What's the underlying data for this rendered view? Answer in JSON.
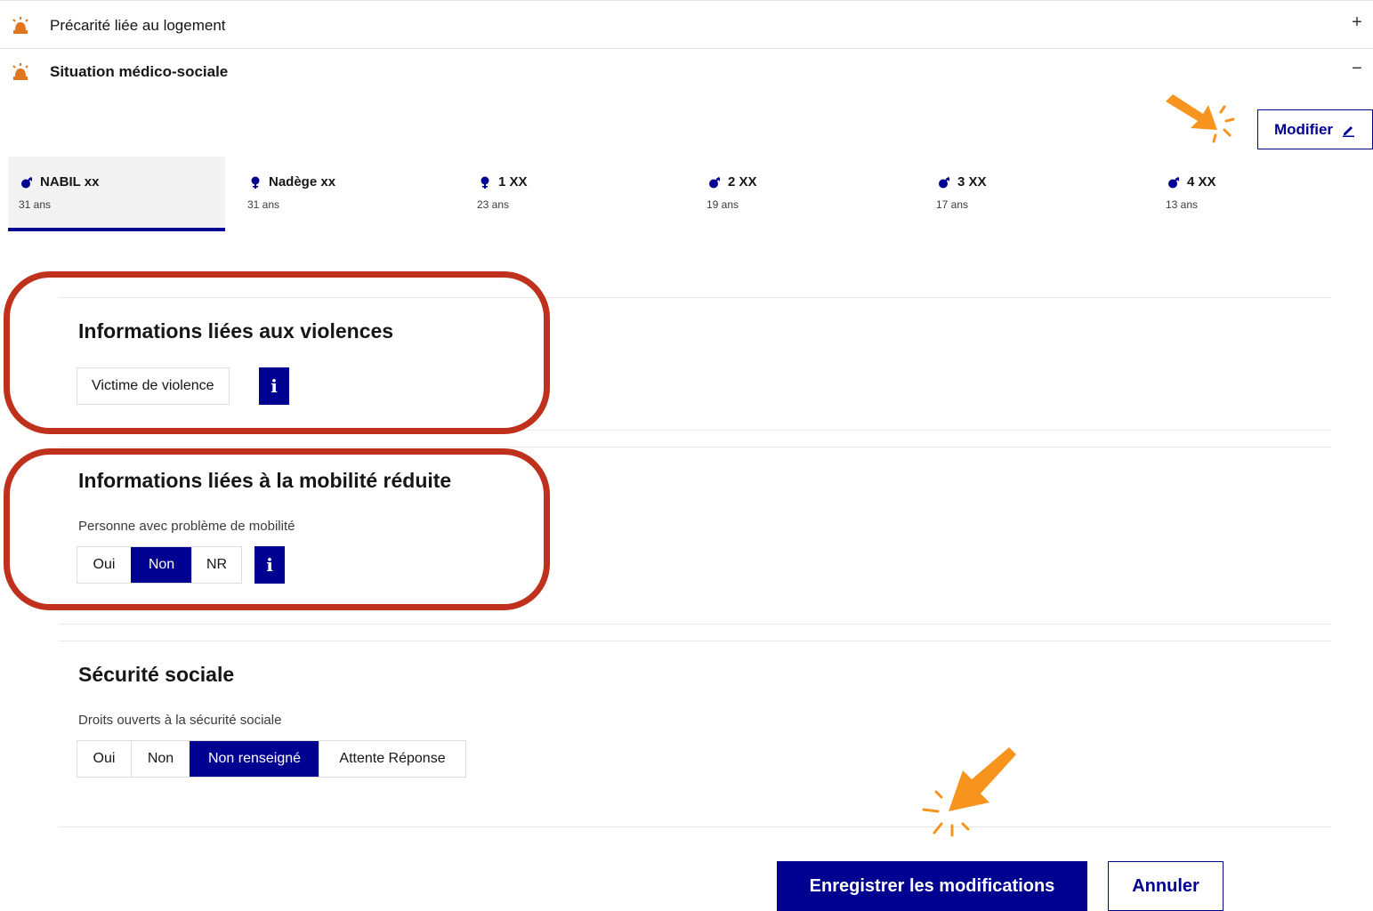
{
  "accordion": {
    "item1": {
      "title": "Précarité liée au logement",
      "toggle": "+"
    },
    "item2": {
      "title": "Situation médico-sociale",
      "toggle": "−"
    }
  },
  "toolbar": {
    "modifier_label": "Modifier"
  },
  "persons": [
    {
      "name": "NABIL xx",
      "age": "31 ans",
      "gender": "male",
      "active": true
    },
    {
      "name": "Nadège xx",
      "age": "31 ans",
      "gender": "female",
      "active": false
    },
    {
      "name": "1 XX",
      "age": "23 ans",
      "gender": "female",
      "active": false
    },
    {
      "name": "2 XX",
      "age": "19 ans",
      "gender": "male",
      "active": false
    },
    {
      "name": "3 XX",
      "age": "17 ans",
      "gender": "male",
      "active": false
    },
    {
      "name": "4 XX",
      "age": "13 ans",
      "gender": "male",
      "active": false
    }
  ],
  "violence": {
    "title": "Informations liées aux violences",
    "victim_label": "Victime de violence",
    "info_icon": "info-icon"
  },
  "mobility": {
    "title": "Informations liées à la mobilité réduite",
    "label": "Personne avec problème de mobilité",
    "options": [
      "Oui",
      "Non",
      "NR"
    ],
    "selected": "Non"
  },
  "security": {
    "title": "Sécurité sociale",
    "label": "Droits ouverts à la sécurité sociale",
    "options": [
      "Oui",
      "Non",
      "Non renseigné",
      "Attente Réponse"
    ],
    "selected": "Non renseigné"
  },
  "actions": {
    "save_label": "Enregistrer les modifications",
    "cancel_label": "Annuler"
  },
  "colors": {
    "primary": "#000091",
    "highlight": "#c0311d",
    "pointer": "#f7941d",
    "icon": "#e1761e"
  }
}
